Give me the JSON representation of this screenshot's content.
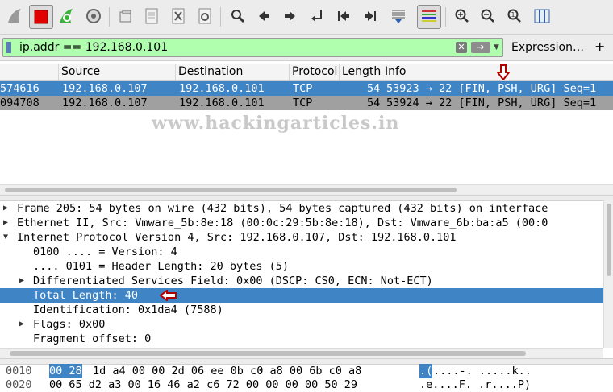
{
  "toolbar": {
    "buttons": [
      {
        "name": "start-capture-icon"
      },
      {
        "name": "stop-capture-icon"
      },
      {
        "name": "restart-capture-icon"
      },
      {
        "name": "capture-options-icon"
      },
      {
        "name": "open-file-icon"
      },
      {
        "name": "save-file-icon"
      },
      {
        "name": "close-file-icon"
      },
      {
        "name": "reload-file-icon"
      },
      {
        "name": "find-packet-icon"
      },
      {
        "name": "go-back-icon"
      },
      {
        "name": "go-forward-icon"
      },
      {
        "name": "go-to-packet-icon"
      },
      {
        "name": "go-first-packet-icon"
      },
      {
        "name": "go-last-packet-icon"
      },
      {
        "name": "autoscroll-icon"
      },
      {
        "name": "colorize-icon"
      },
      {
        "name": "zoom-in-icon"
      },
      {
        "name": "zoom-out-icon"
      },
      {
        "name": "zoom-normal-icon"
      },
      {
        "name": "resize-columns-icon"
      }
    ]
  },
  "filter": {
    "value": "ip.addr == 192.168.0.101",
    "background": "#afffaf",
    "expression_label": "Expression…",
    "add_label": "+"
  },
  "packet_list": {
    "columns": [
      "Source",
      "Destination",
      "Protocol",
      "Length",
      "Info"
    ],
    "rows": [
      {
        "no_time": "574616",
        "source": "192.168.0.107",
        "destination": "192.168.0.101",
        "protocol": "TCP",
        "length": "54",
        "info": "53923 → 22 [FIN, PSH, URG] Seq=1",
        "selected": true
      },
      {
        "no_time": "094708",
        "source": "192.168.0.107",
        "destination": "192.168.0.101",
        "protocol": "TCP",
        "length": "54",
        "info": "53924 → 22 [FIN, PSH, URG] Seq=1",
        "selected": false
      }
    ],
    "watermark": "www.hackingarticles.in"
  },
  "details": {
    "rows": [
      {
        "toggle": "▶",
        "text": "Frame 205: 54 bytes on wire (432 bits), 54 bytes captured (432 bits) on interface"
      },
      {
        "toggle": "▶",
        "text": "Ethernet II, Src: Vmware_5b:8e:18 (00:0c:29:5b:8e:18), Dst: Vmware_6b:ba:a5 (00:0"
      },
      {
        "toggle": "▼",
        "text": "Internet Protocol Version 4, Src: 192.168.0.107, Dst: 192.168.0.101"
      },
      {
        "toggle": "",
        "text": "0100 .... = Version: 4"
      },
      {
        "toggle": "",
        "text": ".... 0101 = Header Length: 20 bytes (5)"
      },
      {
        "toggle": "▶",
        "text": "Differentiated Services Field: 0x00 (DSCP: CS0, ECN: Not-ECT)"
      },
      {
        "toggle": "",
        "text": "Total Length: 40"
      },
      {
        "toggle": "",
        "text": "Identification: 0x1da4 (7588)"
      },
      {
        "toggle": "▶",
        "text": "Flags: 0x00"
      },
      {
        "toggle": "",
        "text": "Fragment offset: 0"
      }
    ]
  },
  "bytes": {
    "rows": [
      {
        "offset": "0010",
        "hex_sel": "00 28",
        "hex_rest": "1d a4 00 00 2d 06  ee 0b c0 a8 00 6b c0 a8",
        "ascii_sel": ".(",
        "ascii_rest": "....-. .....k.."
      },
      {
        "offset": "0020",
        "hex_sel": "",
        "hex_rest": "00 65 d2 a3 00 16 46 a2  c6 72 00 00 00 00 50 29",
        "ascii_sel": "",
        "ascii_rest": ".e....F. .r....P)"
      }
    ]
  },
  "colors": {
    "selection": "#3f84c4",
    "annotation_arrow": "#b00000"
  }
}
